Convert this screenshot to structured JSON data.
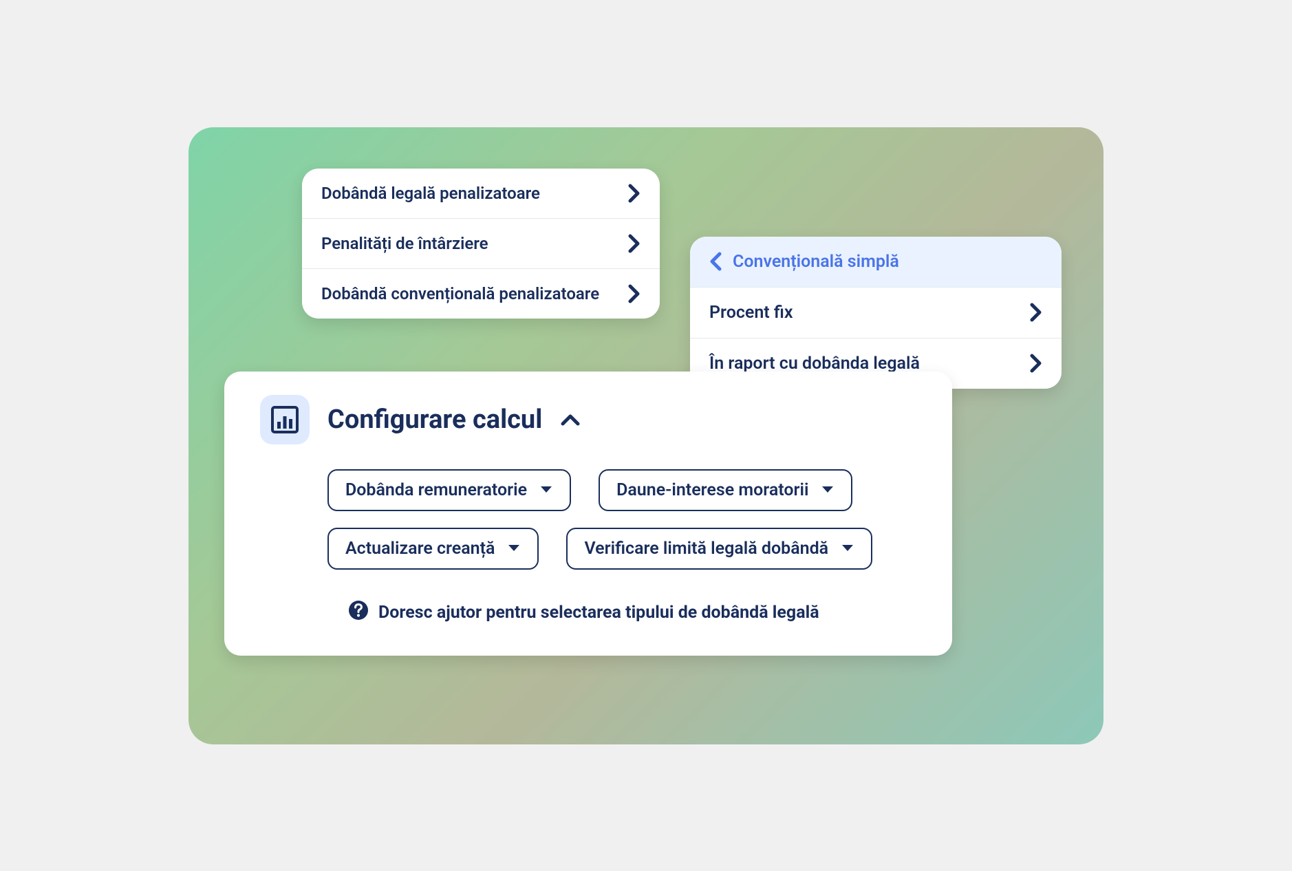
{
  "menuA": {
    "items": [
      {
        "label": "Dobândă legală penalizatoare"
      },
      {
        "label": "Penalități de întârziere"
      },
      {
        "label": "Dobândă convențională penalizatoare"
      }
    ]
  },
  "menuB": {
    "header": {
      "label": "Convențională simplă"
    },
    "items": [
      {
        "label": "Procent fix"
      },
      {
        "label": "În raport cu dobânda legală"
      }
    ]
  },
  "panel": {
    "title": "Configurare calcul",
    "chips": [
      {
        "label": "Dobânda remuneratorie"
      },
      {
        "label": "Daune-interese moratorii"
      },
      {
        "label": "Actualizare creanță"
      },
      {
        "label": "Verificare limită legală dobândă"
      }
    ],
    "help": "Doresc ajutor pentru selectarea tipului de dobândă legală"
  }
}
